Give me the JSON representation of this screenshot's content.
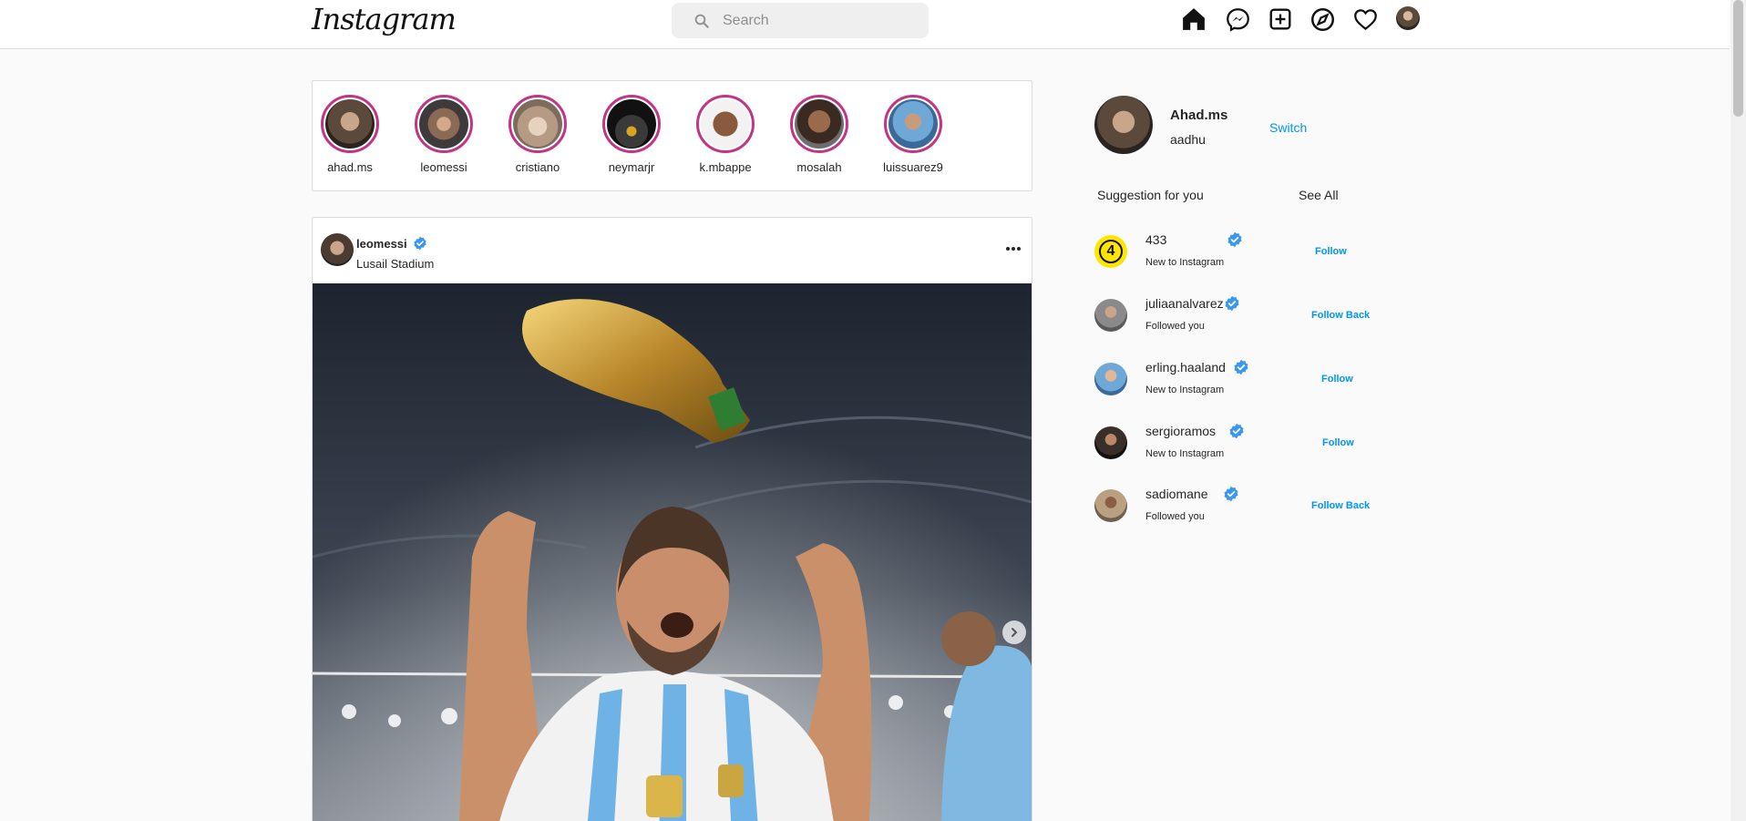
{
  "header": {
    "logo": "Instagram",
    "search_placeholder": "Search",
    "icons": [
      "home-icon",
      "messenger-icon",
      "new-post-icon",
      "explore-icon",
      "activity-heart-icon"
    ]
  },
  "stories": [
    {
      "username": "ahad.ms"
    },
    {
      "username": "leomessi"
    },
    {
      "username": "cristiano"
    },
    {
      "username": "neymarjr"
    },
    {
      "username": "k.mbappe"
    },
    {
      "username": "mosalah"
    },
    {
      "username": "luissuarez9"
    }
  ],
  "post": {
    "username": "leomessi",
    "location": "Lusail Stadium"
  },
  "sidebar": {
    "profile": {
      "name": "Ahad.ms",
      "subtitle": "aadhu",
      "switch_label": "Switch"
    },
    "suggestions_title": "Suggestion for you",
    "see_all_label": "See All",
    "suggestions": [
      {
        "name": "433",
        "subtitle": "New to Instagram",
        "action": "Follow"
      },
      {
        "name": "juliaanalvarez",
        "subtitle": "Followed you",
        "action": "Follow Back"
      },
      {
        "name": "erling.haaland",
        "subtitle": "New to Instagram",
        "action": "Follow"
      },
      {
        "name": "sergioramos",
        "subtitle": "New to Instagram",
        "action": "Follow"
      },
      {
        "name": "sadiomane",
        "subtitle": "Followed you",
        "action": "Follow Back"
      }
    ]
  },
  "colors": {
    "accent": "#0095f6",
    "story_ring": "#c13584",
    "verified": "#3897f0"
  }
}
